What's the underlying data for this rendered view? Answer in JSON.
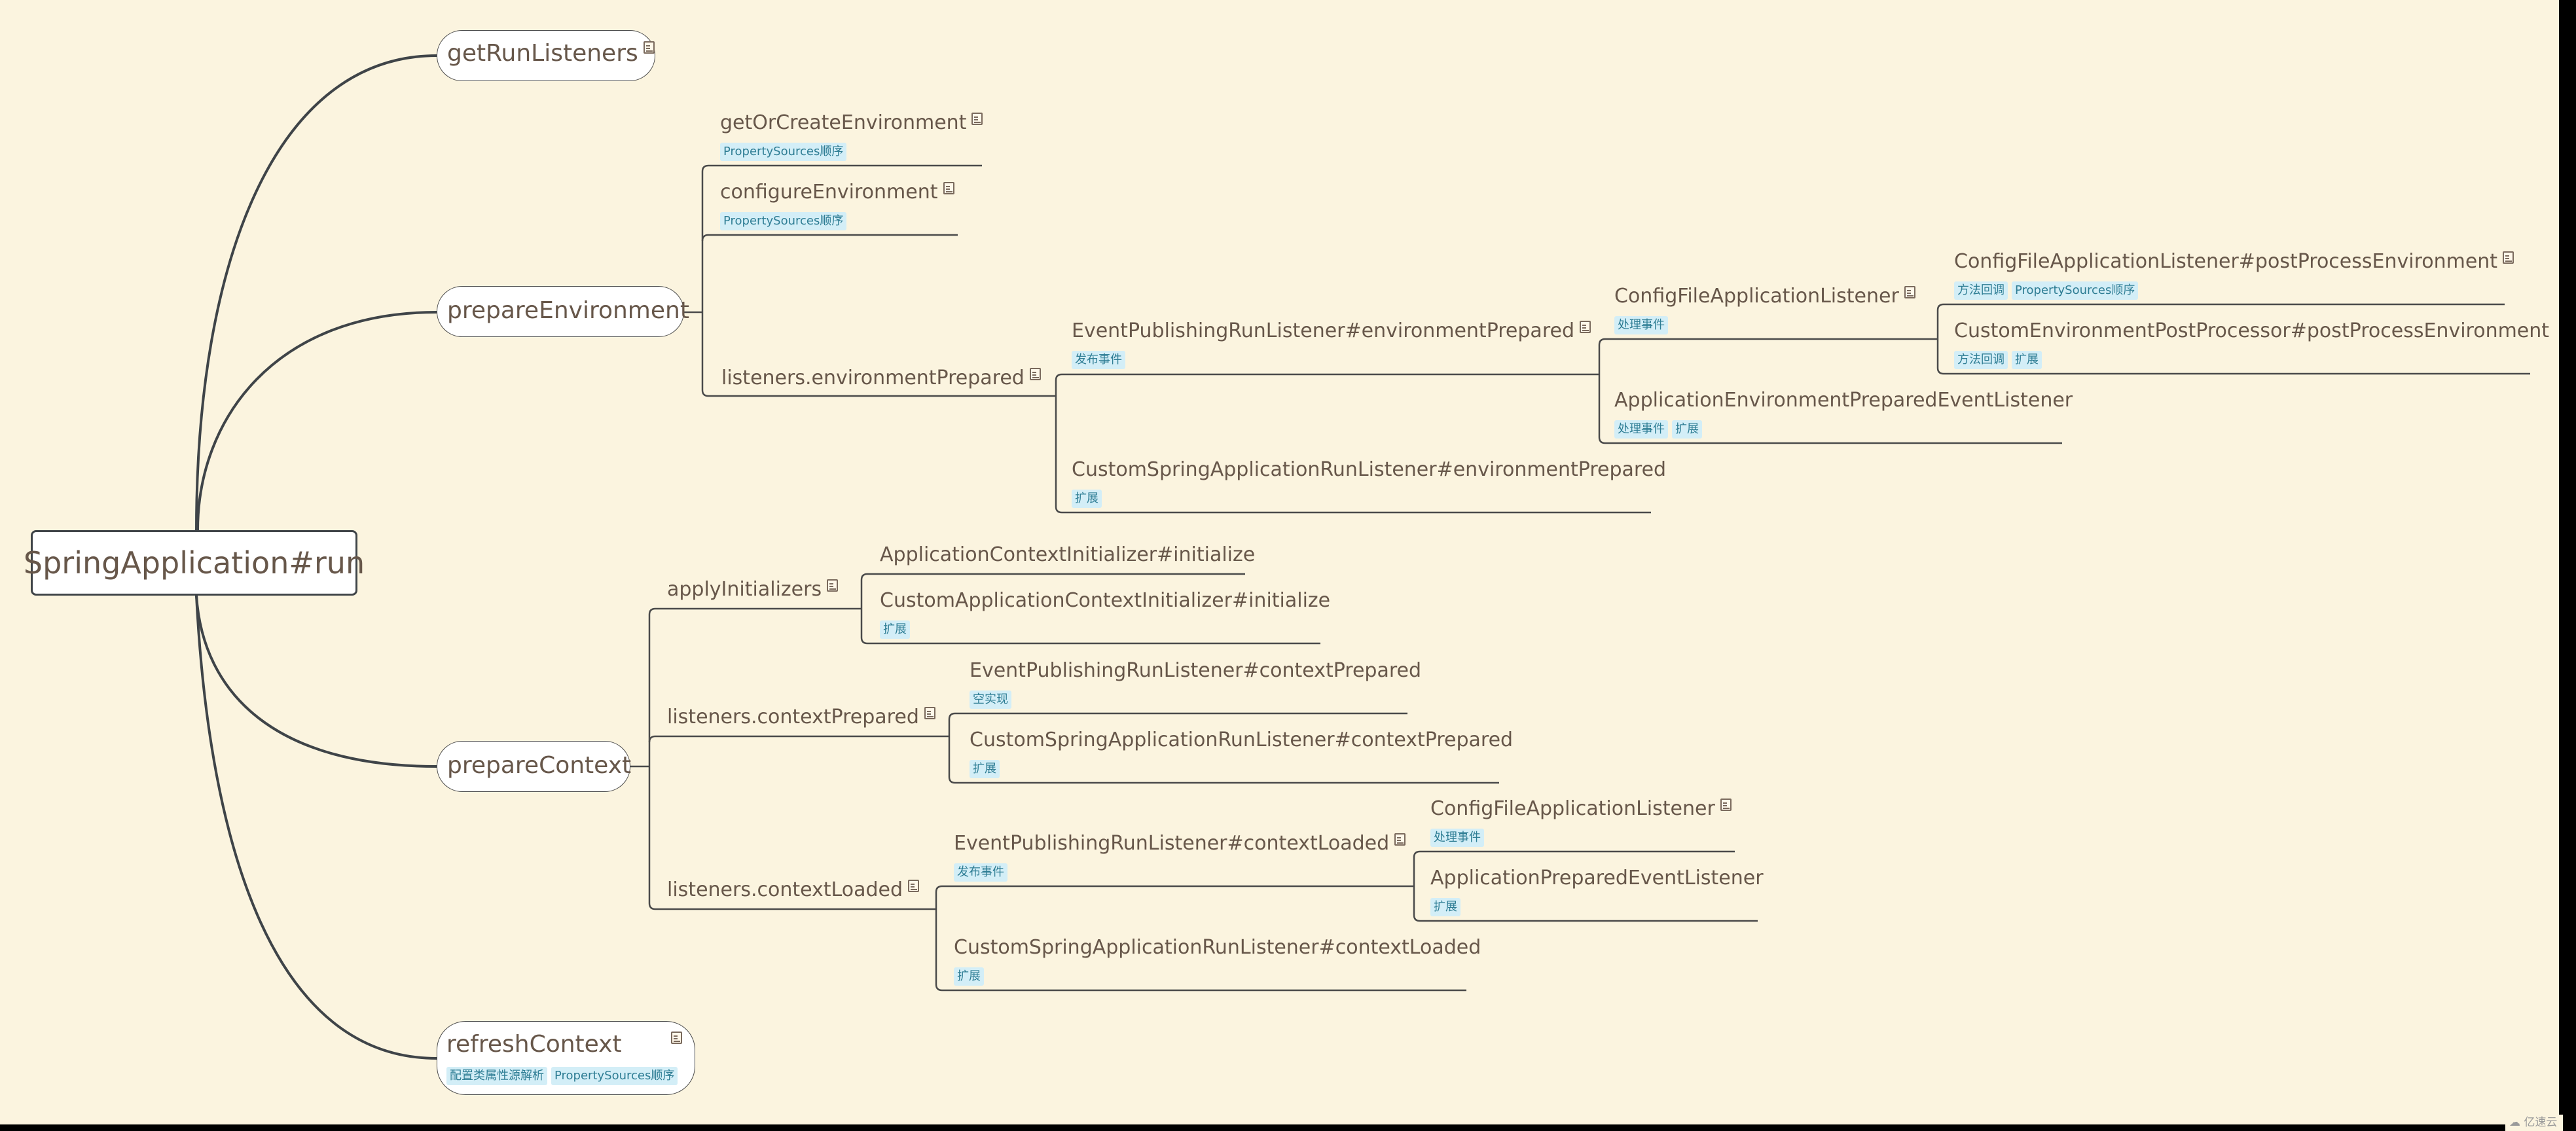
{
  "root": {
    "label": "SpringApplication#run"
  },
  "branches": {
    "getRunListeners": {
      "label": "getRunListeners",
      "has_note": true
    },
    "prepareEnvironment": {
      "label": "prepareEnvironment",
      "children": {
        "getOrCreateEnvironment": {
          "label": "getOrCreateEnvironment",
          "has_note": true,
          "tags": [
            "PropertySources顺序"
          ]
        },
        "configureEnvironment": {
          "label": "configureEnvironment",
          "has_note": true,
          "tags": [
            "PropertySources顺序"
          ]
        },
        "environmentPrepared": {
          "label": "listeners.environmentPrepared",
          "has_note": true,
          "children": {
            "eprlEnvPrepared": {
              "label": "EventPublishingRunListener#environmentPrepared",
              "has_note": true,
              "tags": [
                "发布事件"
              ],
              "children": {
                "configFileListener": {
                  "label": "ConfigFileApplicationListener",
                  "has_note": true,
                  "tags": [
                    "处理事件"
                  ],
                  "children": {
                    "configFilePostProcess": {
                      "label": "ConfigFileApplicationListener#postProcessEnvironment",
                      "has_note": true,
                      "tags": [
                        "方法回调",
                        "PropertySources顺序"
                      ]
                    },
                    "customEnvPostProcessor": {
                      "label": "CustomEnvironmentPostProcessor#postProcessEnvironment",
                      "tags": [
                        "方法回调",
                        "扩展"
                      ]
                    }
                  }
                },
                "appEnvPreparedListener": {
                  "label": "ApplicationEnvironmentPreparedEventListener",
                  "tags": [
                    "处理事件",
                    "扩展"
                  ]
                }
              }
            },
            "customSarlEnvPrepared": {
              "label": "CustomSpringApplicationRunListener#environmentPrepared",
              "tags": [
                "扩展"
              ]
            }
          }
        }
      }
    },
    "prepareContext": {
      "label": "prepareContext",
      "children": {
        "applyInitializers": {
          "label": "applyInitializers",
          "has_note": true,
          "children": {
            "aciInitialize": {
              "label": "ApplicationContextInitializer#initialize"
            },
            "customAciInitialize": {
              "label": "CustomApplicationContextInitializer#initialize",
              "tags": [
                "扩展"
              ]
            }
          }
        },
        "contextPrepared": {
          "label": "listeners.contextPrepared",
          "has_note": true,
          "children": {
            "eprlCtxPrepared": {
              "label": "EventPublishingRunListener#contextPrepared",
              "tags": [
                "空实现"
              ]
            },
            "customSarlCtxPrepared": {
              "label": "CustomSpringApplicationRunListener#contextPrepared",
              "tags": [
                "扩展"
              ]
            }
          }
        },
        "contextLoaded": {
          "label": "listeners.contextLoaded",
          "has_note": true,
          "children": {
            "eprlCtxLoaded": {
              "label": "EventPublishingRunListener#contextLoaded",
              "has_note": true,
              "tags": [
                "发布事件"
              ],
              "children": {
                "configFileListener2": {
                  "label": "ConfigFileApplicationListener",
                  "has_note": true,
                  "tags": [
                    "处理事件"
                  ]
                },
                "appPreparedListener": {
                  "label": "ApplicationPreparedEventListener",
                  "tags": [
                    "扩展"
                  ]
                }
              }
            },
            "customSarlCtxLoaded": {
              "label": "CustomSpringApplicationRunListener#contextLoaded",
              "tags": [
                "扩展"
              ]
            }
          }
        }
      }
    },
    "refreshContext": {
      "label": "refreshContext",
      "has_note": true,
      "tags": [
        "配置类属性源解析",
        "PropertySources顺序"
      ]
    }
  },
  "watermark": {
    "text": "亿速云",
    "icon": "cloud-logo-icon"
  },
  "colors": {
    "background": "#fbf4df",
    "text": "#67574a",
    "line": "#4a4a4a",
    "tag_bg": "#d3eef7",
    "tag_text": "#2e7d94"
  }
}
